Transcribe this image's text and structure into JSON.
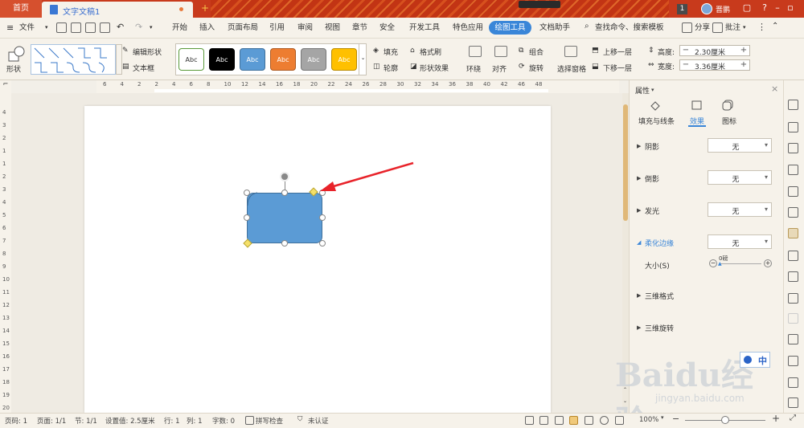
{
  "titlebar": {
    "home_tab": "首页",
    "doc_tab": "文字文稿1",
    "add_tab": "+",
    "user_count": "1",
    "user_name": "晋鹏"
  },
  "menu": {
    "file": "文件",
    "items": [
      "开始",
      "插入",
      "页面布局",
      "引用",
      "审阅",
      "视图",
      "章节",
      "安全",
      "开发工具",
      "特色应用"
    ],
    "active_tab": "绘图工具",
    "assistant": "文档助手",
    "search": "查找命令、搜索模板",
    "share": "分享",
    "annotate": "批注"
  },
  "ribbon": {
    "shape": "形状",
    "edit_shape": "编辑形状",
    "textbox": "文本框",
    "style_label": "Abc",
    "fill": "填充",
    "format_painter": "格式刷",
    "outline": "轮廓",
    "shape_effects": "形状效果",
    "wrap": "环绕",
    "align": "对齐",
    "group": "组合",
    "rotate": "旋转",
    "selection_pane": "选择窗格",
    "bring_forward": "上移一层",
    "send_backward": "下移一层",
    "height_label": "高度:",
    "height_value": "2.30厘米",
    "width_label": "宽度:",
    "width_value": "3.36厘米",
    "styles": [
      {
        "bg": "#ffffff",
        "fg": "#333333",
        "border": "#5a9a3a"
      },
      {
        "bg": "#000000",
        "fg": "#ffffff",
        "border": "#000000"
      },
      {
        "bg": "#5b9bd5",
        "fg": "#ffffff",
        "border": "#41719c"
      },
      {
        "bg": "#ed7d31",
        "fg": "#ffffff",
        "border": "#ae5a21"
      },
      {
        "bg": "#a5a5a5",
        "fg": "#ffffff",
        "border": "#787878"
      },
      {
        "bg": "#ffc000",
        "fg": "#ffffff",
        "border": "#bc8c00"
      }
    ]
  },
  "ruler": {
    "labels": [
      "6",
      "4",
      "2",
      "2",
      "4",
      "6",
      "8",
      "10",
      "12",
      "14",
      "16",
      "18",
      "20",
      "22",
      "24",
      "26",
      "28",
      "30",
      "32",
      "34",
      "36",
      "38",
      "40",
      "42",
      "46",
      "48"
    ],
    "vlabels": [
      "4",
      "3",
      "2",
      "1",
      "1",
      "2",
      "3",
      "4",
      "5",
      "6",
      "7",
      "8",
      "9",
      "10",
      "11",
      "12",
      "13",
      "14",
      "15",
      "16",
      "17",
      "18",
      "19",
      "20"
    ]
  },
  "panel": {
    "title": "属性",
    "tabs": [
      "填充与线条",
      "效果",
      "图标"
    ],
    "shadow": "阴影",
    "reflection": "倒影",
    "glow": "发光",
    "soft_edges": "柔化边缘",
    "size": "大小(S)",
    "size_value": "0磅",
    "format_3d": "三维格式",
    "rotation_3d": "三维旋转",
    "none": "无"
  },
  "status": {
    "page_num": "页码: 1",
    "pages": "页面: 1/1",
    "section": "节: 1/1",
    "setting": "设置值: 2.5厘米",
    "row": "行: 1",
    "col": "列: 1",
    "words": "字数: 0",
    "spell": "拼写检查",
    "auth": "未认证",
    "zoom": "100%"
  },
  "watermark": {
    "brand": "Baidu经验",
    "url": "jingyan.baidu.com"
  },
  "ime": "中",
  "colors": {
    "title_bar": "#c83a1c",
    "accent": "#3a86d8",
    "shape_fill": "#5b9bd5",
    "arrow": "#e8232a"
  }
}
